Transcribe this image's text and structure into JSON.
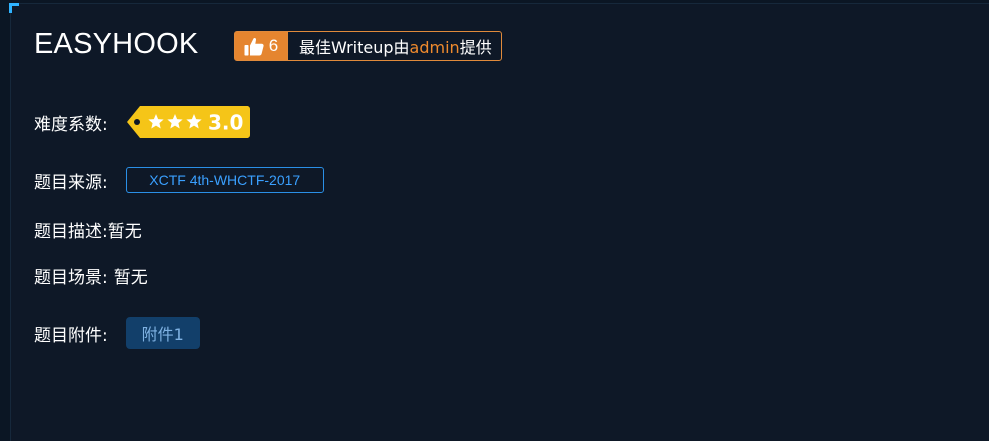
{
  "challenge": {
    "title": "EASYHOOK"
  },
  "writeup_badge": {
    "like_count": "6",
    "text_prefix": "最佳Writeup由",
    "author": "admin",
    "text_suffix": "提供",
    "accent_color": "#e5852f",
    "icon": "thumbs-up-icon"
  },
  "difficulty": {
    "label": "难度系数:",
    "stars": 3,
    "score": "3.0",
    "tag_color": "#f5c518"
  },
  "source": {
    "label": "题目来源:",
    "value": "XCTF 4th-WHCTF-2017"
  },
  "description": {
    "label": "题目描述:",
    "value": "暂无"
  },
  "scenario": {
    "label": "题目场景:",
    "value": "暂无"
  },
  "attachment": {
    "label": "题目附件:",
    "button_label": "附件1"
  },
  "colors": {
    "background": "#0e1827",
    "link_blue": "#3aa0ff",
    "corner_accent": "#2fb3ff"
  }
}
